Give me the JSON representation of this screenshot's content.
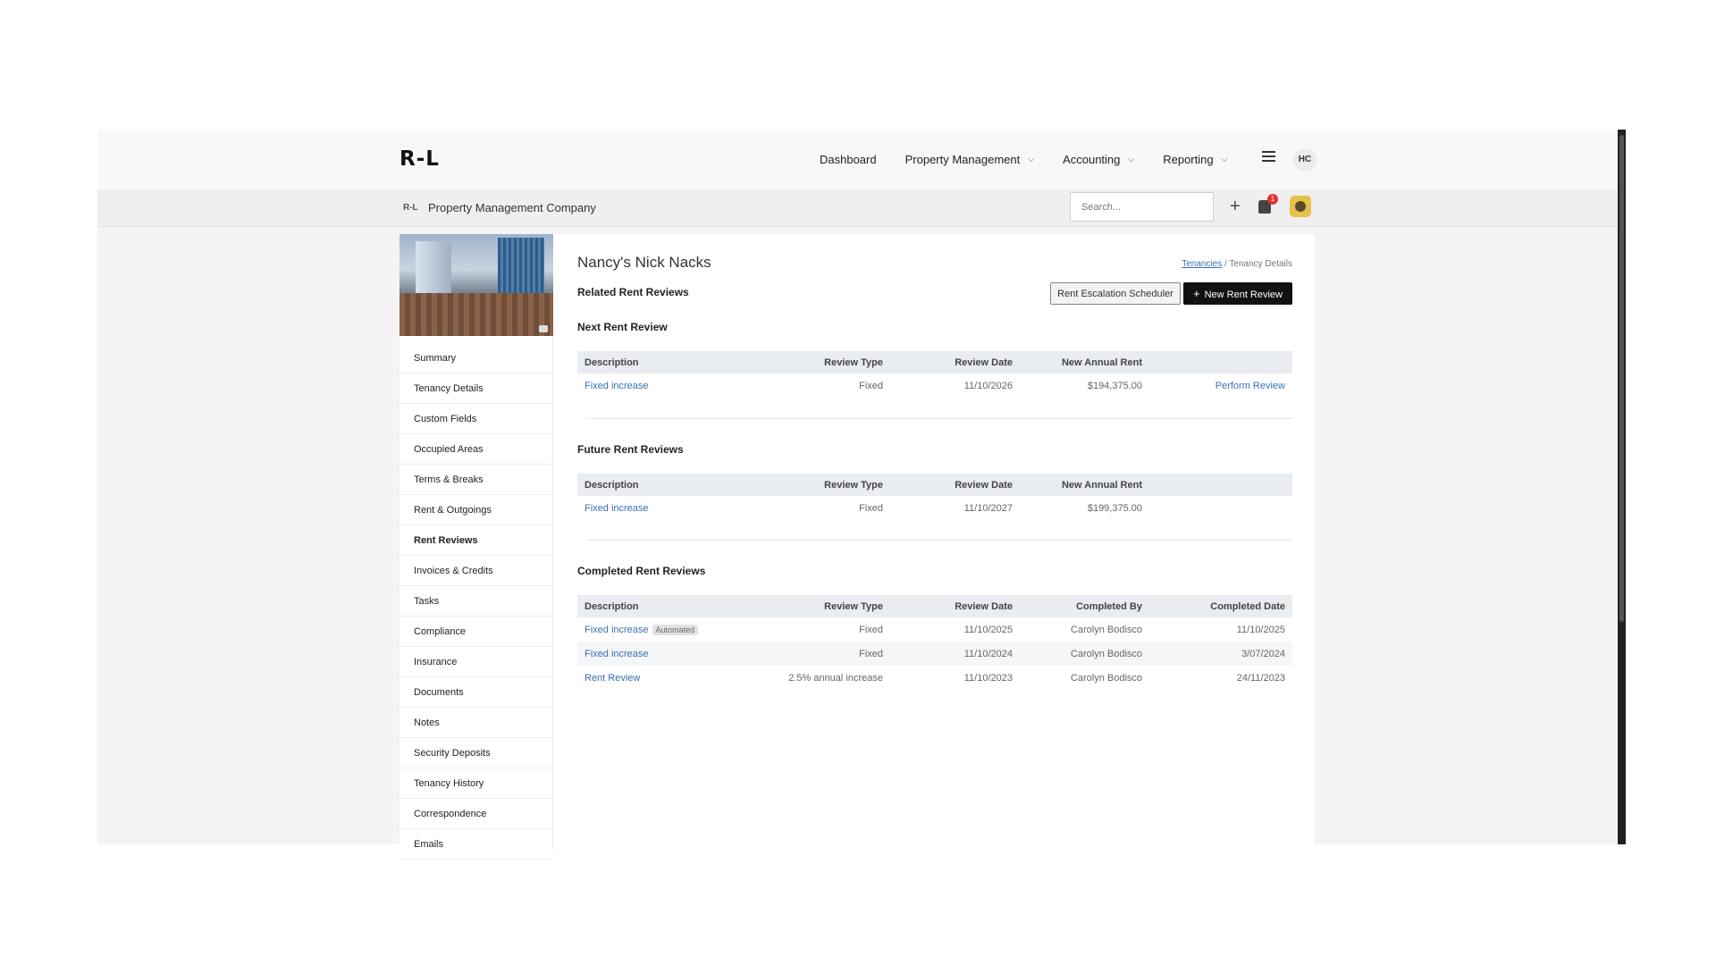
{
  "brand": {
    "logo_text": "R-L"
  },
  "topnav": {
    "items": [
      {
        "label": "Dashboard",
        "has_dropdown": false
      },
      {
        "label": "Property Management",
        "has_dropdown": true
      },
      {
        "label": "Accounting",
        "has_dropdown": true
      },
      {
        "label": "Reporting",
        "has_dropdown": true
      }
    ],
    "user_initials": "HC"
  },
  "subheader": {
    "company_icon": "R-L",
    "company_name": "Property Management Company",
    "search_placeholder": "Search...",
    "notification_count": "1"
  },
  "sidebar": {
    "items": [
      "Summary",
      "Tenancy Details",
      "Custom Fields",
      "Occupied Areas",
      "Terms & Breaks",
      "Rent & Outgoings",
      "Rent Reviews",
      "Invoices & Credits",
      "Tasks",
      "Compliance",
      "Insurance",
      "Documents",
      "Notes",
      "Security Deposits",
      "Tenancy History",
      "Correspondence",
      "Emails"
    ],
    "active": "Rent Reviews"
  },
  "page": {
    "tenant_name": "Nancy's Nick Nacks",
    "breadcrumb": {
      "link": "Tenancies",
      "separator": "/",
      "current": "Tenancy Details"
    },
    "related_title": "Related Rent Reviews",
    "buttons": {
      "escalation": "Rent Escalation Scheduler",
      "new_review": "New Rent Review"
    }
  },
  "next_review": {
    "title": "Next Rent Review",
    "headers": [
      "Description",
      "Review Type",
      "Review Date",
      "New Annual Rent",
      ""
    ],
    "rows": [
      {
        "description": "Fixed increase",
        "type": "Fixed",
        "date": "11/10/2026",
        "rent": "$194,375.00",
        "action": "Perform Review"
      }
    ]
  },
  "future_reviews": {
    "title": "Future Rent Reviews",
    "headers": [
      "Description",
      "Review Type",
      "Review Date",
      "New Annual Rent",
      ""
    ],
    "rows": [
      {
        "description": "Fixed increase",
        "type": "Fixed",
        "date": "11/10/2027",
        "rent": "$199,375.00"
      }
    ]
  },
  "completed_reviews": {
    "title": "Completed Rent Reviews",
    "headers": [
      "Description",
      "Review Type",
      "Review Date",
      "Completed By",
      "Completed Date"
    ],
    "rows": [
      {
        "description": "Fixed increase",
        "tag": "Automated",
        "type": "Fixed",
        "date": "11/10/2025",
        "by": "Carolyn Bodisco",
        "completed": "11/10/2025"
      },
      {
        "description": "Fixed increase",
        "tag": "",
        "type": "Fixed",
        "date": "11/10/2024",
        "by": "Carolyn Bodisco",
        "completed": "3/07/2024"
      },
      {
        "description": "Rent Review",
        "tag": "",
        "type": "2.5% annual increase",
        "date": "11/10/2023",
        "by": "Carolyn Bodisco",
        "completed": "24/11/2023"
      }
    ]
  }
}
